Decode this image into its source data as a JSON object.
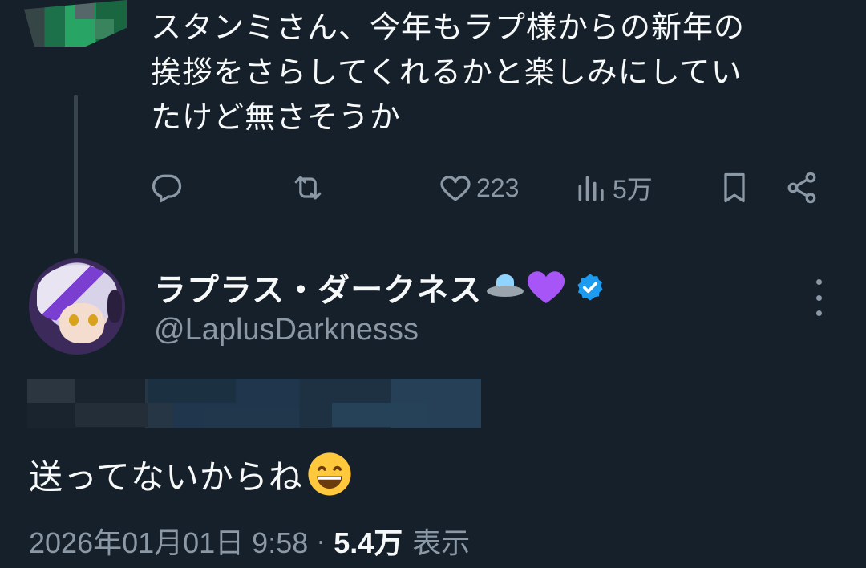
{
  "parent_tweet": {
    "text": "スタンミさん、今年もラプ様からの新年の\n挨拶をさらしてくれるかと楽しみにしてい\nたけど無さそうか",
    "actions": {
      "reply_icon": "reply-icon",
      "retweet_icon": "retweet-icon",
      "like_icon": "heart-outline-icon",
      "like_count": "223",
      "views_icon": "bar-chart-icon",
      "views_count": "5万",
      "bookmark_icon": "bookmark-icon",
      "share_icon": "share-icon"
    }
  },
  "reply": {
    "display_name": "ラプラス・ダークネス",
    "emojis": [
      "ufo-emoji",
      "purple-heart-emoji"
    ],
    "verified_color": "#1d9bf0",
    "handle": "@LaplusDarknesss",
    "text": "送ってないからね",
    "text_emoji": "grinning-face-emoji",
    "timestamp": "2026年01月01日 9:58",
    "separator": "·",
    "views": "5.4万",
    "views_label": "表示"
  },
  "colors": {
    "background": "#15202b",
    "primary_text": "#f7f9f9",
    "secondary_text": "#8b98a5",
    "verified": "#1d9bf0",
    "purple_heart": "#a855f7"
  }
}
